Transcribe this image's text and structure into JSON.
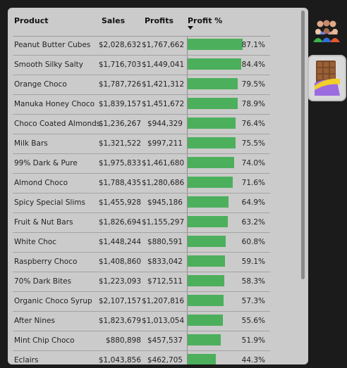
{
  "table": {
    "headers": {
      "product": "Product",
      "sales": "Sales",
      "profits": "Profits",
      "profit_pct": "Profit %"
    },
    "sort_column": "Profit %",
    "sort_direction": "descending",
    "bar_color": "#4caf5c",
    "rows": [
      {
        "product": "Peanut Butter Cubes",
        "sales": "$2,028,632",
        "profits": "$1,767,662",
        "profit_pct": "87.1%",
        "pct_value": 87.1
      },
      {
        "product": "Smooth Silky Salty",
        "sales": "$1,716,703",
        "profits": "$1,449,041",
        "profit_pct": "84.4%",
        "pct_value": 84.4
      },
      {
        "product": "Orange Choco",
        "sales": "$1,787,726",
        "profits": "$1,421,312",
        "profit_pct": "79.5%",
        "pct_value": 79.5
      },
      {
        "product": "Manuka Honey Choco",
        "sales": "$1,839,157",
        "profits": "$1,451,672",
        "profit_pct": "78.9%",
        "pct_value": 78.9
      },
      {
        "product": "Choco Coated Almonds",
        "sales": "$1,236,267",
        "profits": "$944,329",
        "profit_pct": "76.4%",
        "pct_value": 76.4
      },
      {
        "product": "Milk Bars",
        "sales": "$1,321,522",
        "profits": "$997,211",
        "profit_pct": "75.5%",
        "pct_value": 75.5
      },
      {
        "product": "99% Dark & Pure",
        "sales": "$1,975,833",
        "profits": "$1,461,680",
        "profit_pct": "74.0%",
        "pct_value": 74.0
      },
      {
        "product": "Almond Choco",
        "sales": "$1,788,435",
        "profits": "$1,280,686",
        "profit_pct": "71.6%",
        "pct_value": 71.6
      },
      {
        "product": "Spicy Special Slims",
        "sales": "$1,455,928",
        "profits": "$945,186",
        "profit_pct": "64.9%",
        "pct_value": 64.9
      },
      {
        "product": "Fruit & Nut Bars",
        "sales": "$1,826,694",
        "profits": "$1,155,297",
        "profit_pct": "63.2%",
        "pct_value": 63.2
      },
      {
        "product": "White Choc",
        "sales": "$1,448,244",
        "profits": "$880,591",
        "profit_pct": "60.8%",
        "pct_value": 60.8
      },
      {
        "product": "Raspberry Choco",
        "sales": "$1,408,860",
        "profits": "$833,042",
        "profit_pct": "59.1%",
        "pct_value": 59.1
      },
      {
        "product": "70% Dark Bites",
        "sales": "$1,223,093",
        "profits": "$712,511",
        "profit_pct": "58.3%",
        "pct_value": 58.3
      },
      {
        "product": "Organic Choco Syrup",
        "sales": "$2,107,157",
        "profits": "$1,207,816",
        "profit_pct": "57.3%",
        "pct_value": 57.3
      },
      {
        "product": "After Nines",
        "sales": "$1,823,679",
        "profits": "$1,013,054",
        "profit_pct": "55.6%",
        "pct_value": 55.6
      },
      {
        "product": "Mint Chip Choco",
        "sales": "$880,898",
        "profits": "$457,537",
        "profit_pct": "51.9%",
        "pct_value": 51.9
      },
      {
        "product": "Eclairs",
        "sales": "$1,043,856",
        "profits": "$462,705",
        "profit_pct": "44.3%",
        "pct_value": 44.3
      }
    ]
  },
  "side_icons": [
    {
      "name": "people-icon"
    },
    {
      "name": "chocolate-icon",
      "selected": true
    }
  ]
}
